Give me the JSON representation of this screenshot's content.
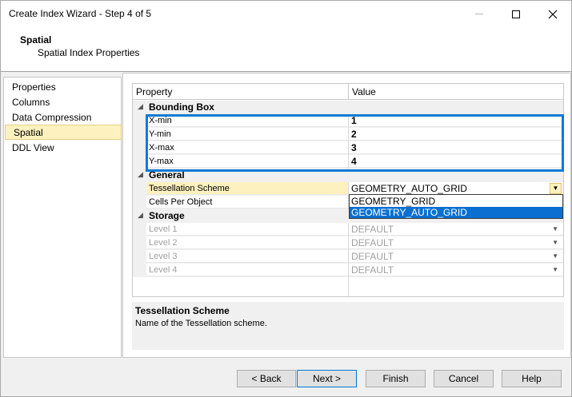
{
  "window": {
    "title": "Create Index Wizard - Step 4 of 5"
  },
  "header": {
    "title": "Spatial",
    "subtitle": "Spatial Index Properties"
  },
  "nav": {
    "items": [
      {
        "label": "Properties",
        "selected": false
      },
      {
        "label": "Columns",
        "selected": false
      },
      {
        "label": "Data Compression",
        "selected": false
      },
      {
        "label": "Spatial",
        "selected": true
      },
      {
        "label": "DDL View",
        "selected": false
      }
    ]
  },
  "grid": {
    "headers": {
      "property": "Property",
      "value": "Value"
    },
    "bounding_box": {
      "label": "Bounding Box",
      "rows": [
        {
          "name": "X-min",
          "value": "1"
        },
        {
          "name": "Y-min",
          "value": "2"
        },
        {
          "name": "X-max",
          "value": "3"
        },
        {
          "name": "Y-max",
          "value": "4"
        }
      ]
    },
    "general": {
      "label": "General",
      "rows": [
        {
          "name": "Tessellation Scheme",
          "value": "GEOMETRY_AUTO_GRID"
        },
        {
          "name": "Cells Per Object",
          "value": ""
        }
      ]
    },
    "storage": {
      "label": "Storage",
      "rows": [
        {
          "name": "Level 1",
          "value": "DEFAULT"
        },
        {
          "name": "Level 2",
          "value": "DEFAULT"
        },
        {
          "name": "Level 3",
          "value": "DEFAULT"
        },
        {
          "name": "Level 4",
          "value": "DEFAULT"
        }
      ]
    },
    "dropdown": {
      "options": [
        "GEOMETRY_GRID",
        "GEOMETRY_AUTO_GRID"
      ],
      "selected": "GEOMETRY_AUTO_GRID"
    }
  },
  "description": {
    "title": "Tessellation Scheme",
    "text": "Name of the Tessellation scheme."
  },
  "buttons": {
    "back": "< Back",
    "next": "Next >",
    "finish": "Finish",
    "cancel": "Cancel",
    "help": "Help"
  },
  "colors": {
    "selection_highlight": "#fdf2bf",
    "dropdown_selected": "#0a6fd1",
    "annotation_border": "#0f7ad6"
  }
}
